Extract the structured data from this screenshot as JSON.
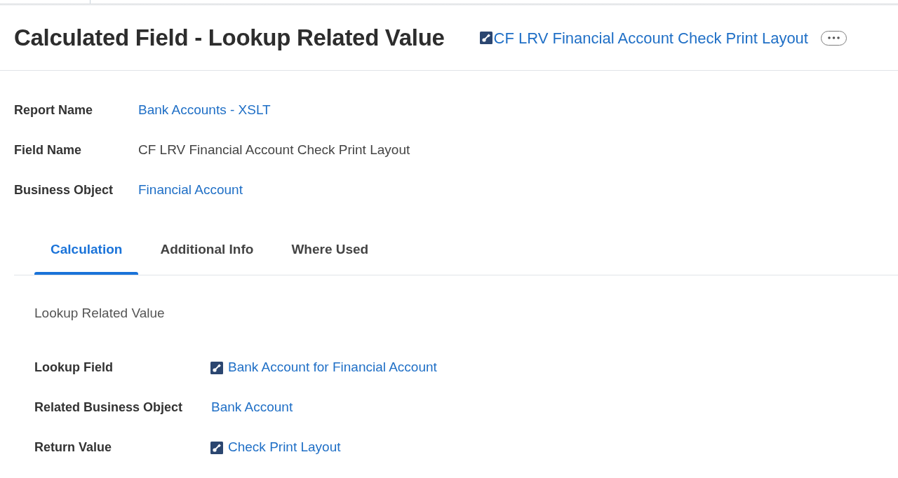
{
  "header": {
    "title": "Calculated Field - Lookup Related Value",
    "record_link": {
      "text": "CF LRV Financial Account Check Print Layout",
      "kind": "related_link"
    }
  },
  "details": [
    {
      "label": "Report Name",
      "value": "Bank Accounts - XSLT",
      "kind": "link"
    },
    {
      "label": "Field Name",
      "value": "CF LRV Financial Account Check Print Layout",
      "kind": "text"
    },
    {
      "label": "Business Object",
      "value": "Financial Account",
      "kind": "link"
    }
  ],
  "tabs": [
    {
      "label": "Calculation",
      "selected": true
    },
    {
      "label": "Additional Info",
      "selected": false
    },
    {
      "label": "Where Used",
      "selected": false
    }
  ],
  "calculation": {
    "type_label": "Lookup Related Value",
    "fields": [
      {
        "label": "Lookup Field",
        "value": "Bank Account for Financial Account",
        "kind": "related_link"
      },
      {
        "label": "Related Business Object",
        "value": "Bank Account",
        "kind": "link"
      },
      {
        "label": "Return Value",
        "value": "Check Print Layout",
        "kind": "related_link"
      }
    ]
  }
}
